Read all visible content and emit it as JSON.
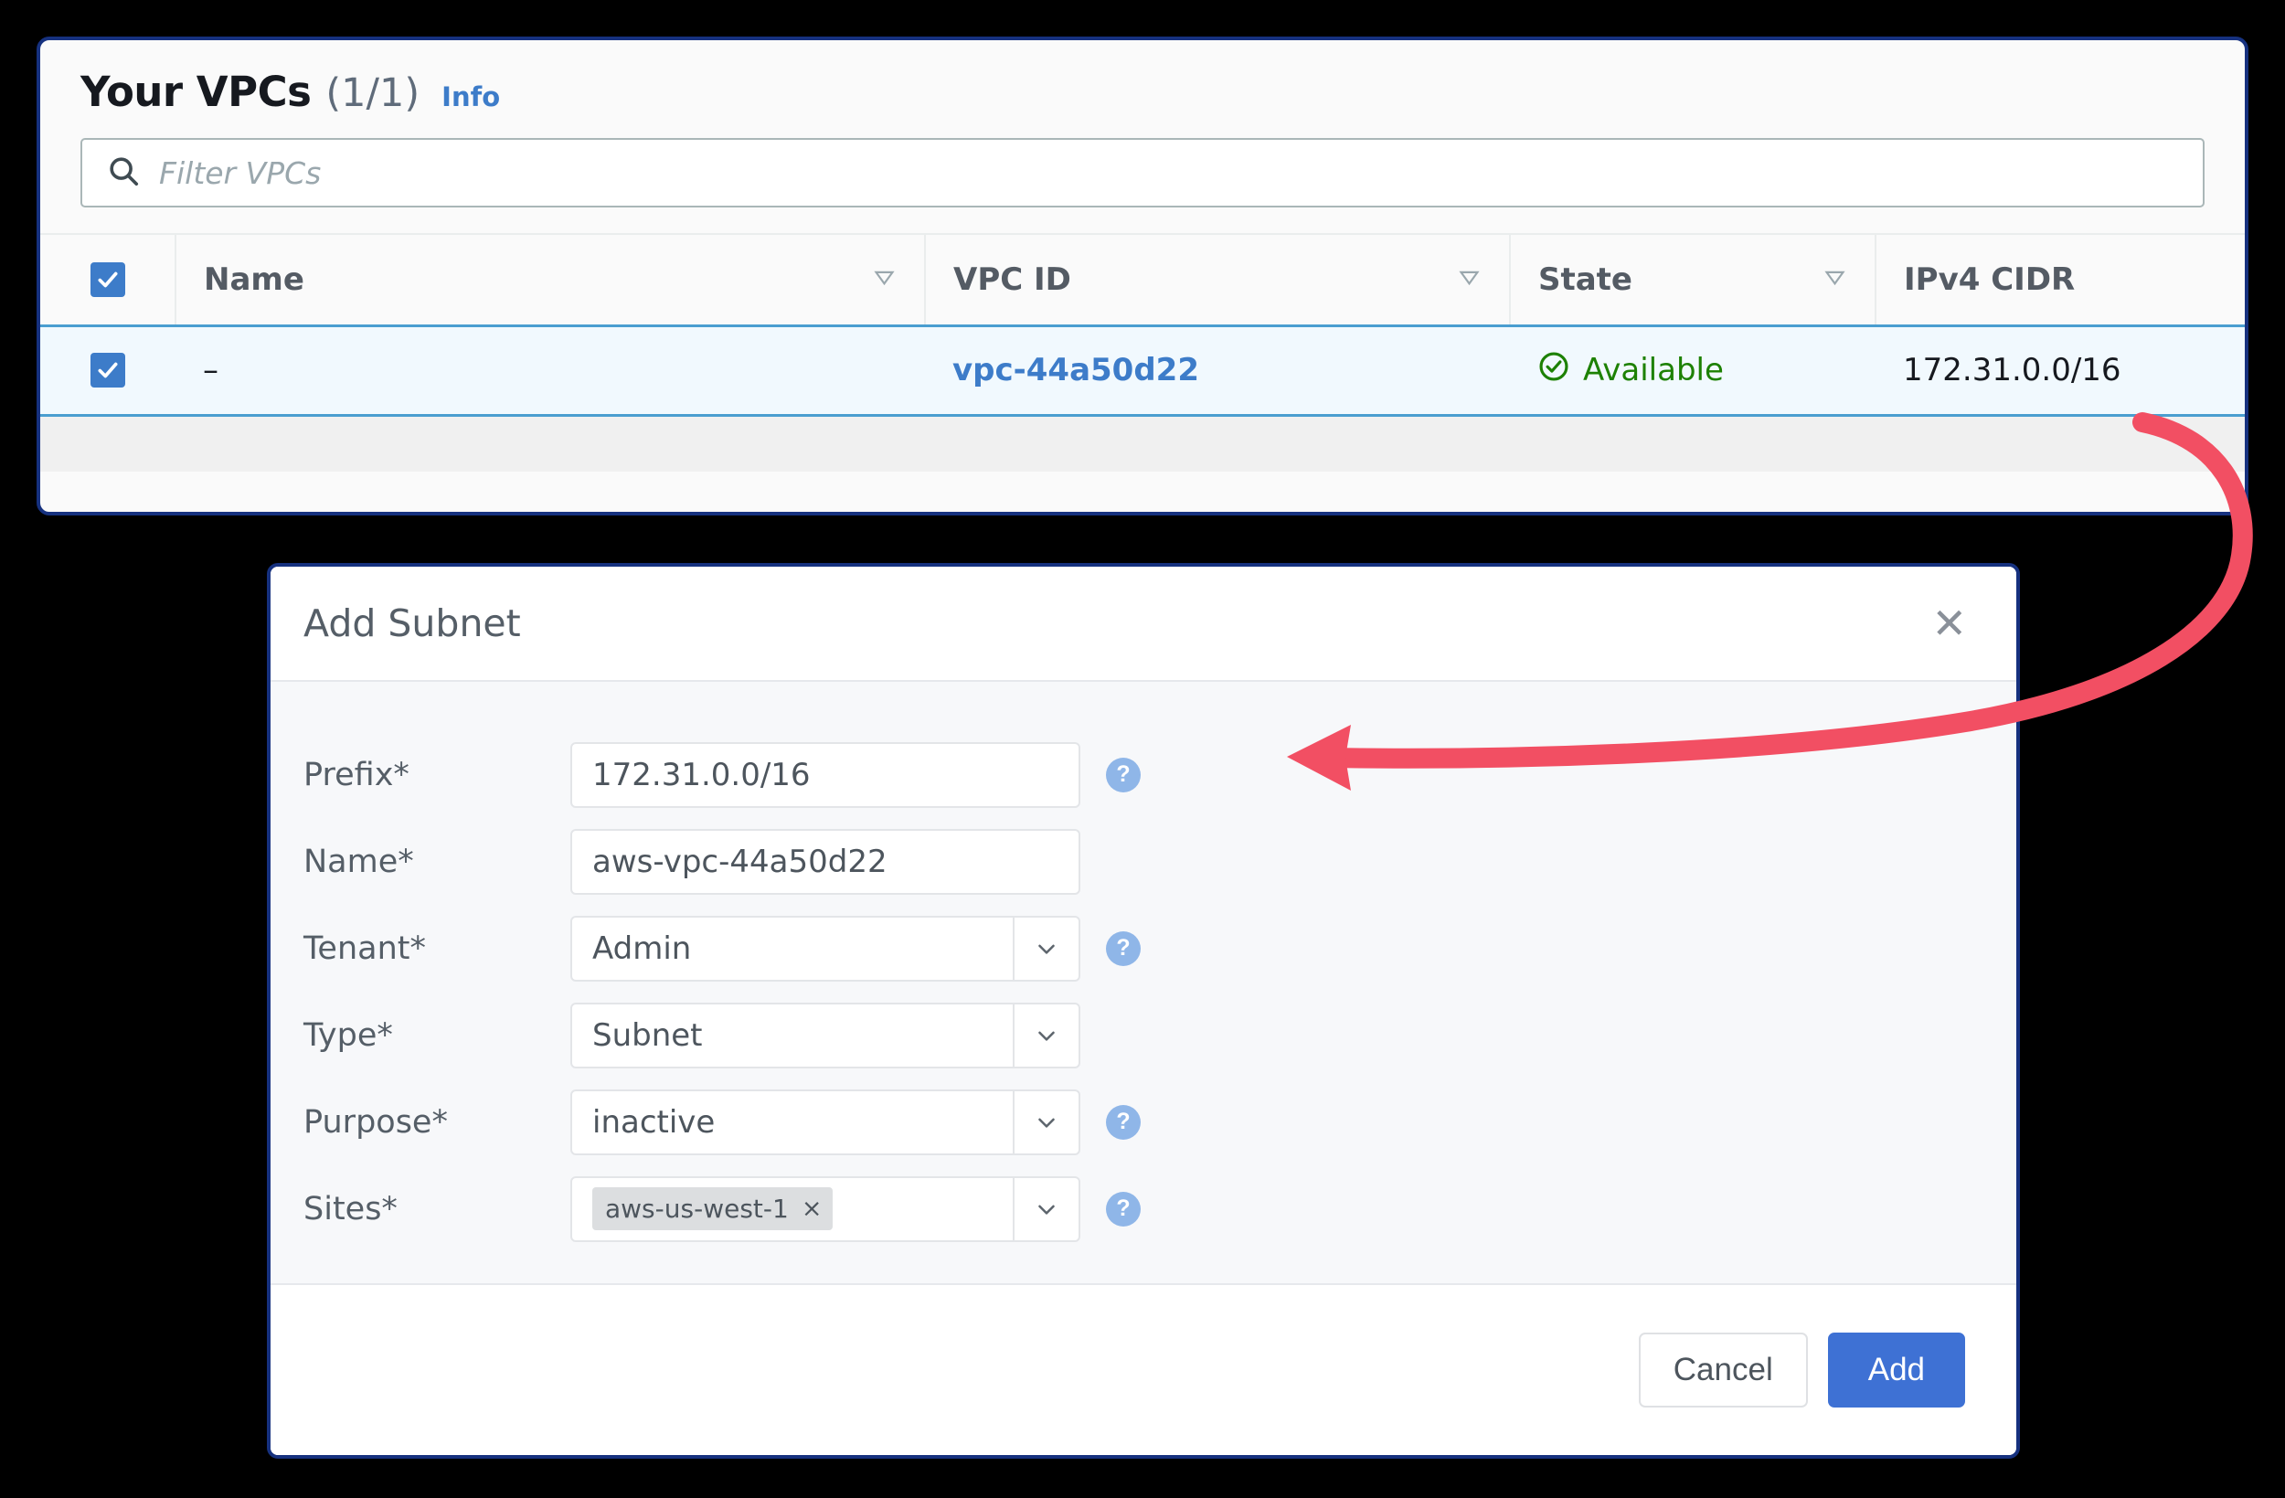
{
  "panel": {
    "title": "Your VPCs",
    "count": "(1/1)",
    "info_label": "Info"
  },
  "search": {
    "placeholder": "Filter VPCs",
    "icon": "search-icon"
  },
  "table": {
    "select_all_checked": true,
    "columns": [
      {
        "label": "Name",
        "sortable": true,
        "sort_icon": "sort-descending-icon"
      },
      {
        "label": "VPC ID",
        "sortable": true,
        "sort_icon": "sort-descending-icon"
      },
      {
        "label": "State",
        "sortable": true,
        "sort_icon": "sort-descending-icon"
      },
      {
        "label": "IPv4 CIDR",
        "sortable": false,
        "sort_icon": ""
      }
    ],
    "rows": [
      {
        "checked": true,
        "name": "–",
        "vpc_id": "vpc-44a50d22",
        "state": "Available",
        "state_icon": "check-circle-icon",
        "ipv4_cidr": "172.31.0.0/16"
      }
    ]
  },
  "modal": {
    "title": "Add Subnet",
    "close_icon": "close-icon",
    "help_icon_glyph": "?",
    "fields": [
      {
        "label": "Prefix*",
        "kind": "text",
        "value": "172.31.0.0/16",
        "help": true
      },
      {
        "label": "Name*",
        "kind": "text",
        "value": "aws-vpc-44a50d22",
        "help": false
      },
      {
        "label": "Tenant*",
        "kind": "select",
        "value": "Admin",
        "help": true
      },
      {
        "label": "Type*",
        "kind": "select",
        "value": "Subnet",
        "help": false
      },
      {
        "label": "Purpose*",
        "kind": "select",
        "value": "inactive",
        "help": true
      },
      {
        "label": "Sites*",
        "kind": "tags",
        "value": "aws-us-west-1",
        "tag_remove": "×",
        "help": true
      }
    ],
    "footer": {
      "cancel_label": "Cancel",
      "add_label": "Add"
    }
  },
  "annotation": {
    "arrow_color": "#f24f63",
    "name": "callout-arrow"
  },
  "colors": {
    "accent_blue": "#3d7cc9",
    "primary_button": "#3e71d4",
    "panel_border": "#16317f",
    "state_green": "#1d8102",
    "selected_row_bg": "#f1f9fe",
    "help_badge": "#8fb6e8"
  }
}
